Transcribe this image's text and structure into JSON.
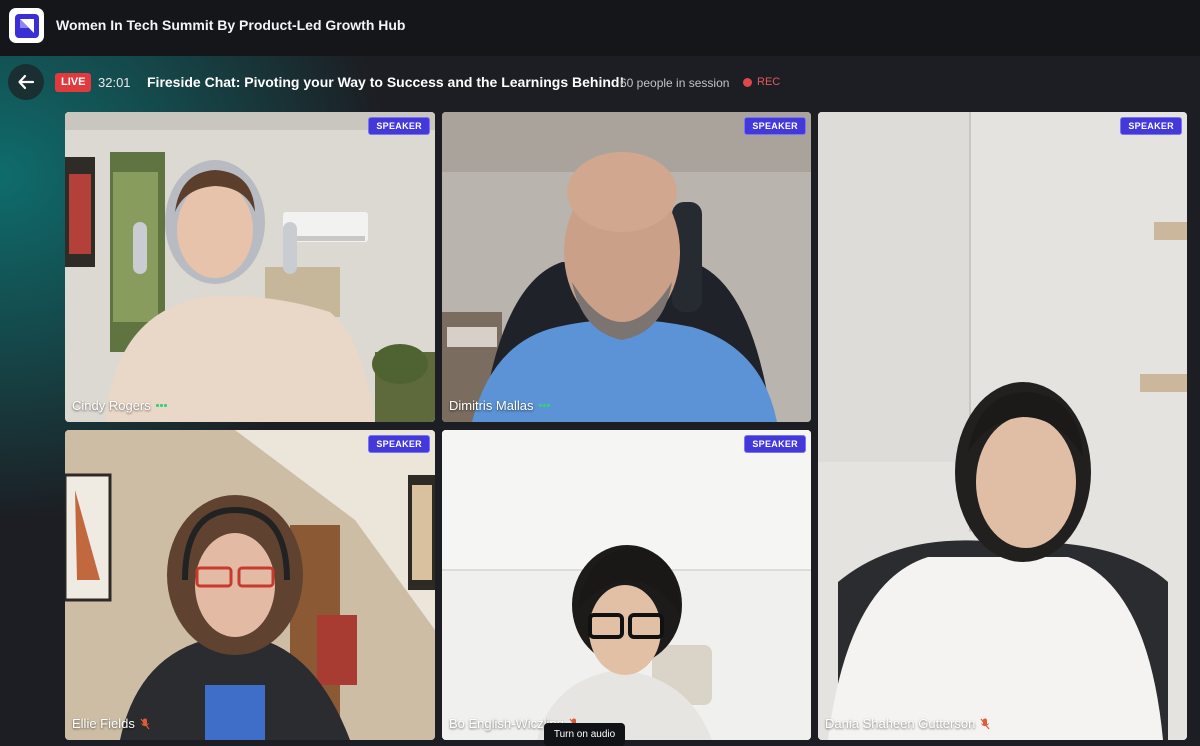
{
  "app": {
    "title": "Women In Tech Summit By Product-Led Growth Hub",
    "logo_icon": "app-logo-icon"
  },
  "session": {
    "live_label": "LIVE",
    "timer": "32:01",
    "title": "Fireside Chat: Pivoting your Way to Success and the Learnings Behind!",
    "people": "60 people in session",
    "rec_label": "REC"
  },
  "participants": [
    {
      "name": "Cindy Rogers",
      "role": "SPEAKER",
      "audio": "speaking"
    },
    {
      "name": "Dimitris Mallas",
      "role": "SPEAKER",
      "audio": "speaking"
    },
    {
      "name": "Dania Shaheen Gutterson",
      "role": "SPEAKER",
      "audio": "muted"
    },
    {
      "name": "Ellie Fields",
      "role": "SPEAKER",
      "audio": "muted"
    },
    {
      "name": "Bo English-Wiczling",
      "role": "SPEAKER",
      "audio": "muted"
    }
  ],
  "tooltip": {
    "text": "Turn on audio"
  },
  "colors": {
    "live": "#e0393e",
    "speaker_badge": "#4338d9",
    "speaking": "#36d07a",
    "muted": "#e05a3a",
    "rec": "#e04848"
  }
}
